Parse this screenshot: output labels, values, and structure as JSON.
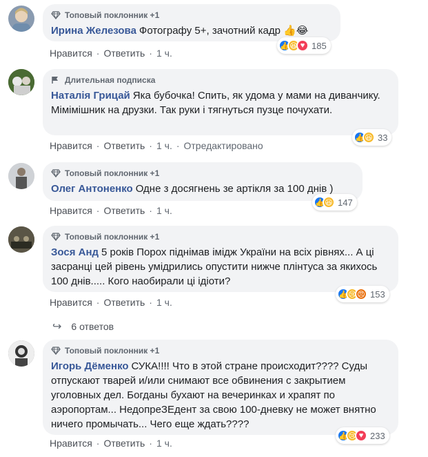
{
  "comments": [
    {
      "badge": "Топовый поклонник +1",
      "author": "Ирина Железова",
      "text": "Фотографу 5+, зачотний кадр 👍😂",
      "actions": [
        "Нравится",
        "Ответить",
        "1 ч."
      ],
      "reactions": [
        "like",
        "haha",
        "love"
      ],
      "count": "185"
    },
    {
      "badge": "Длительная подписка",
      "author": "Наталія Грицай",
      "text": "Яка бубочка! Спить, як удома у мами на диванчику. Мімімішник на друзки. Так руки і тягнуться пузце почухати.",
      "actions": [
        "Нравится",
        "Ответить",
        "1 ч.",
        "Отредактировано"
      ],
      "reactions": [
        "like",
        "haha"
      ],
      "count": "33"
    },
    {
      "badge": "Топовый поклонник +1",
      "author": "Олег Антоненко",
      "text": "Одне з досягнень зе артікля за 100 днів )",
      "actions": [
        "Нравится",
        "Ответить",
        "1 ч."
      ],
      "reactions": [
        "like",
        "haha"
      ],
      "count": "147"
    },
    {
      "badge": "Топовый поклонник +1",
      "author": "Зося Анд",
      "text": "5 років Порох піднімав імідж України на всіх рівнях... А ці засранці цей рівень умідрились опустити нижче плінтуса за якихось 100 днів..... Кого наобирали ці ідіоти?",
      "actions": [
        "Нравится",
        "Ответить",
        "1 ч."
      ],
      "reactions": [
        "like",
        "sad",
        "angry"
      ],
      "count": "153"
    },
    {
      "badge": "Топовый поклонник +1",
      "author": "Игорь Дёменко",
      "text": "СУКА!!!! Что в этой стране происходит???? Суды отпускают тварей и/или снимают все обвинения с закрытием уголовных дел. Богданы бухают на вечеринках и храпят по аэропортам... НедопреЗЕдент за свою 100-дневку не может внятно ничего промычать... Чего еще ждать????",
      "actions": [
        "Нравится",
        "Ответить",
        "1 ч."
      ],
      "reactions": [
        "like",
        "sad",
        "love"
      ],
      "count": "233"
    }
  ],
  "replies_label": "6 ответов",
  "colors": {
    "author": "#385898",
    "bubble": "#f2f3f5",
    "like": "#1877f2"
  }
}
